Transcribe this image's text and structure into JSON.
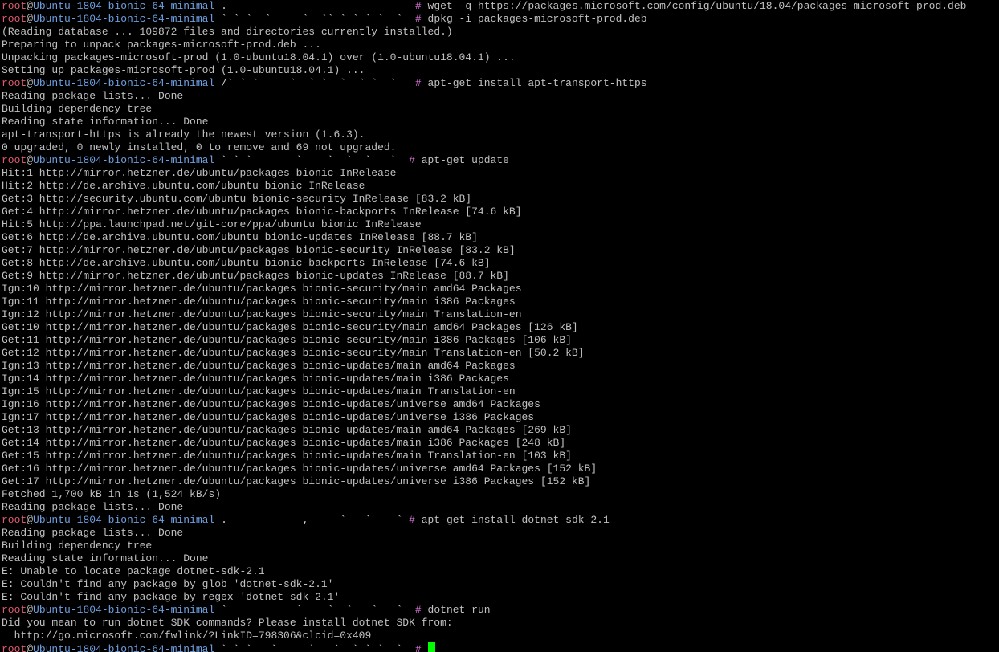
{
  "colors": {
    "background": "#000000",
    "text": "#c0c0c0",
    "user": "#e05a6e",
    "host": "#6e9fe0",
    "prompt_symbol": "#d070d0",
    "cursor": "#00ff00"
  },
  "prompt": {
    "user": "root",
    "at": "@",
    "host": "Ubuntu-1804-bionic-64-minimal",
    "symbol": "#"
  },
  "lines": [
    {
      "type": "prompt",
      "path": " .                              ",
      "cmd": " wget -q https://packages.microsoft.com/config/ubuntu/18.04/packages-microsoft-prod.deb"
    },
    {
      "type": "prompt",
      "path": " ` ` `  `     `  `` ` ` ` `  `  ",
      "cmd": " dpkg -i packages-microsoft-prod.deb"
    },
    {
      "type": "output",
      "text": "(Reading database ... 109872 files and directories currently installed.)"
    },
    {
      "type": "output",
      "text": "Preparing to unpack packages-microsoft-prod.deb ..."
    },
    {
      "type": "output",
      "text": "Unpacking packages-microsoft-prod (1.0-ubuntu18.04.1) over (1.0-ubuntu18.04.1) ..."
    },
    {
      "type": "output",
      "text": "Setting up packages-microsoft-prod (1.0-ubuntu18.04.1) ..."
    },
    {
      "type": "prompt",
      "path": " /` ` `     `  ` `  `  ` `  `   ",
      "cmd": " apt-get install apt-transport-https"
    },
    {
      "type": "output",
      "text": "Reading package lists... Done"
    },
    {
      "type": "output",
      "text": "Building dependency tree"
    },
    {
      "type": "output",
      "text": "Reading state information... Done"
    },
    {
      "type": "output",
      "text": "apt-transport-https is already the newest version (1.6.3)."
    },
    {
      "type": "output",
      "text": "0 upgraded, 0 newly installed, 0 to remove and 69 not upgraded."
    },
    {
      "type": "prompt",
      "path": " ` ` `       `    `  `  `   `  ",
      "cmd": " apt-get update"
    },
    {
      "type": "output",
      "text": "Hit:1 http://mirror.hetzner.de/ubuntu/packages bionic InRelease"
    },
    {
      "type": "output",
      "text": "Hit:2 http://de.archive.ubuntu.com/ubuntu bionic InRelease"
    },
    {
      "type": "output",
      "text": "Get:3 http://security.ubuntu.com/ubuntu bionic-security InRelease [83.2 kB]"
    },
    {
      "type": "output",
      "text": "Get:4 http://mirror.hetzner.de/ubuntu/packages bionic-backports InRelease [74.6 kB]"
    },
    {
      "type": "output",
      "text": "Hit:5 http://ppa.launchpad.net/git-core/ppa/ubuntu bionic InRelease"
    },
    {
      "type": "output",
      "text": "Get:6 http://de.archive.ubuntu.com/ubuntu bionic-updates InRelease [88.7 kB]"
    },
    {
      "type": "output",
      "text": "Get:7 http://mirror.hetzner.de/ubuntu/packages bionic-security InRelease [83.2 kB]"
    },
    {
      "type": "output",
      "text": "Get:8 http://de.archive.ubuntu.com/ubuntu bionic-backports InRelease [74.6 kB]"
    },
    {
      "type": "output",
      "text": "Get:9 http://mirror.hetzner.de/ubuntu/packages bionic-updates InRelease [88.7 kB]"
    },
    {
      "type": "output",
      "text": "Ign:10 http://mirror.hetzner.de/ubuntu/packages bionic-security/main amd64 Packages"
    },
    {
      "type": "output",
      "text": "Ign:11 http://mirror.hetzner.de/ubuntu/packages bionic-security/main i386 Packages"
    },
    {
      "type": "output",
      "text": "Ign:12 http://mirror.hetzner.de/ubuntu/packages bionic-security/main Translation-en"
    },
    {
      "type": "output",
      "text": "Get:10 http://mirror.hetzner.de/ubuntu/packages bionic-security/main amd64 Packages [126 kB]"
    },
    {
      "type": "output",
      "text": "Get:11 http://mirror.hetzner.de/ubuntu/packages bionic-security/main i386 Packages [106 kB]"
    },
    {
      "type": "output",
      "text": "Get:12 http://mirror.hetzner.de/ubuntu/packages bionic-security/main Translation-en [50.2 kB]"
    },
    {
      "type": "output",
      "text": "Ign:13 http://mirror.hetzner.de/ubuntu/packages bionic-updates/main amd64 Packages"
    },
    {
      "type": "output",
      "text": "Ign:14 http://mirror.hetzner.de/ubuntu/packages bionic-updates/main i386 Packages"
    },
    {
      "type": "output",
      "text": "Ign:15 http://mirror.hetzner.de/ubuntu/packages bionic-updates/main Translation-en"
    },
    {
      "type": "output",
      "text": "Ign:16 http://mirror.hetzner.de/ubuntu/packages bionic-updates/universe amd64 Packages"
    },
    {
      "type": "output",
      "text": "Ign:17 http://mirror.hetzner.de/ubuntu/packages bionic-updates/universe i386 Packages"
    },
    {
      "type": "output",
      "text": "Get:13 http://mirror.hetzner.de/ubuntu/packages bionic-updates/main amd64 Packages [269 kB]"
    },
    {
      "type": "output",
      "text": "Get:14 http://mirror.hetzner.de/ubuntu/packages bionic-updates/main i386 Packages [248 kB]"
    },
    {
      "type": "output",
      "text": "Get:15 http://mirror.hetzner.de/ubuntu/packages bionic-updates/main Translation-en [103 kB]"
    },
    {
      "type": "output",
      "text": "Get:16 http://mirror.hetzner.de/ubuntu/packages bionic-updates/universe amd64 Packages [152 kB]"
    },
    {
      "type": "output",
      "text": "Get:17 http://mirror.hetzner.de/ubuntu/packages bionic-updates/universe i386 Packages [152 kB]"
    },
    {
      "type": "output",
      "text": "Fetched 1,700 kB in 1s (1,524 kB/s)"
    },
    {
      "type": "output",
      "text": "Reading package lists... Done"
    },
    {
      "type": "prompt",
      "path": " .            ,     `   `    ` ",
      "cmd": " apt-get install dotnet-sdk-2.1"
    },
    {
      "type": "output",
      "text": "Reading package lists... Done"
    },
    {
      "type": "output",
      "text": "Building dependency tree"
    },
    {
      "type": "output",
      "text": "Reading state information... Done"
    },
    {
      "type": "output",
      "text": "E: Unable to locate package dotnet-sdk-2.1"
    },
    {
      "type": "output",
      "text": "E: Couldn't find any package by glob 'dotnet-sdk-2.1'"
    },
    {
      "type": "output",
      "text": "E: Couldn't find any package by regex 'dotnet-sdk-2.1'"
    },
    {
      "type": "prompt",
      "path": " `           `    `  `   `   `  ",
      "cmd": " dotnet run"
    },
    {
      "type": "output",
      "text": "Did you mean to run dotnet SDK commands? Please install dotnet SDK from:"
    },
    {
      "type": "output",
      "text": "  http://go.microsoft.com/fwlink/?LinkID=798306&clcid=0x409"
    },
    {
      "type": "prompt",
      "path": " ` ` `   `     `   `  ` ` `  `  ",
      "cmd": " ",
      "cursor": true
    }
  ]
}
